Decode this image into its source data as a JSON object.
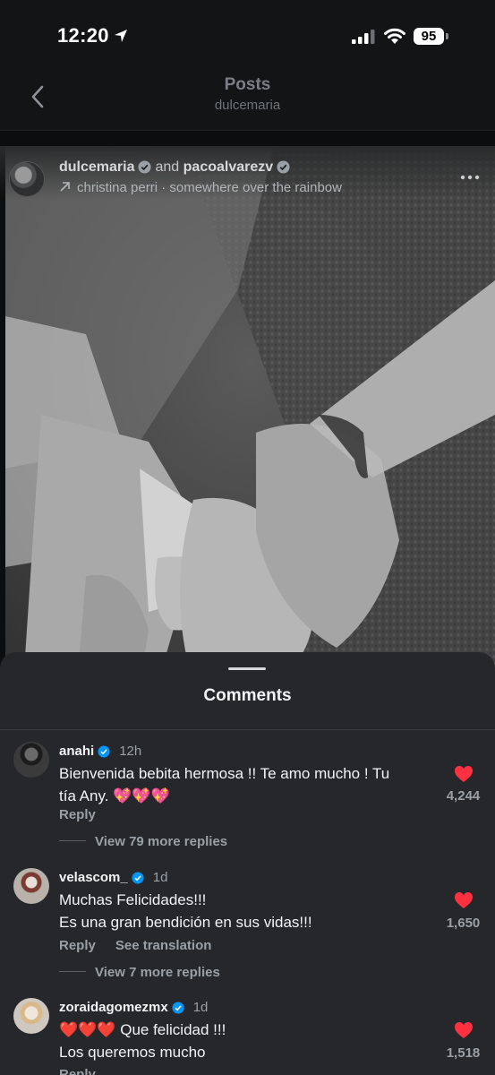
{
  "status_bar": {
    "time": "12:20",
    "battery": "95",
    "icons": [
      "location-arrow-icon",
      "signal-icon",
      "wifi-icon",
      "battery-icon"
    ]
  },
  "header": {
    "title": "Posts",
    "subtitle": "dulcemaria"
  },
  "post": {
    "user1": "dulcemaria",
    "and_text": "and",
    "user2": "pacoalvarezv",
    "audio": "christina perri · somewhere over the rainbow"
  },
  "comments_sheet": {
    "title": "Comments",
    "comments": [
      {
        "username": "anahi",
        "time": "12h",
        "text_line1": "Bienvenida bebita hermosa !! Te amo mucho ! Tu",
        "text_line2": "tía Any. 💖💖💖",
        "reply": "Reply",
        "more_replies": "View 79 more replies",
        "likes": "4,244"
      },
      {
        "username": "velascom_",
        "time": "1d",
        "text_line1": "Muchas Felicidades!!!",
        "text_line2": "Es una gran bendición en sus vidas!!!",
        "reply": "Reply",
        "translate": "See translation",
        "more_replies": "View 7 more replies",
        "likes": "1,650"
      },
      {
        "username": "zoraidagomezmx",
        "time": "1d",
        "text_line1": "❤️❤️❤️ Que felicidad !!!",
        "text_line2": "Los queremos mucho",
        "reply": "Reply",
        "likes": "1,518"
      }
    ]
  },
  "colors": {
    "background": "#121416",
    "sheet": "#25272b",
    "heart": "#ff3040",
    "verified": "#0095f6"
  }
}
